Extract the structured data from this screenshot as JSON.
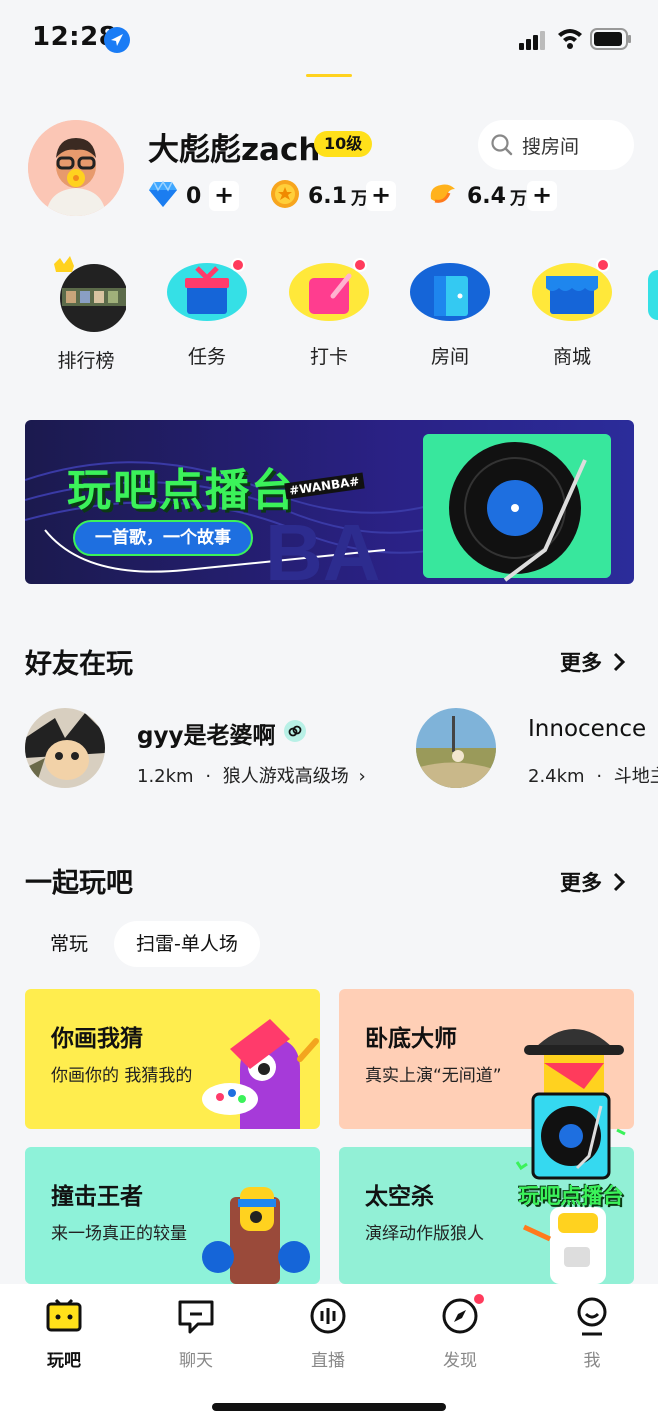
{
  "status_bar": {
    "time": "12:28"
  },
  "profile": {
    "username": "大彪彪zach",
    "level": "10级",
    "search_label": "搜房间",
    "diamonds": "0",
    "coins": {
      "value": "6.1",
      "unit": "万"
    },
    "beans": {
      "value": "6.4",
      "unit": "万"
    },
    "plus": "+"
  },
  "quick_nav": [
    {
      "label": "排行榜"
    },
    {
      "label": "任务"
    },
    {
      "label": "打卡"
    },
    {
      "label": "房间"
    },
    {
      "label": "商城"
    }
  ],
  "banner": {
    "title": "玩吧点播台",
    "tag": "#WANBA#",
    "slogan": "一首歌，一个故事"
  },
  "friends_section": {
    "title": "好友在玩",
    "more": "更多",
    "friends": [
      {
        "name": "gyy是老婆啊",
        "distance": "1.2km",
        "activity": "狼人游戏高级场"
      },
      {
        "name": "Innocence",
        "distance": "2.4km",
        "activity": "斗地主"
      }
    ]
  },
  "play_section": {
    "title": "一起玩吧",
    "more": "更多",
    "tabs": [
      {
        "label": "常玩"
      },
      {
        "label": "扫雷-单人场"
      }
    ],
    "games": [
      {
        "title": "你画我猜",
        "subtitle": "你画你的 我猜我的",
        "bg": "#ffed4e"
      },
      {
        "title": "卧底大师",
        "subtitle": "真实上演“无间道”",
        "bg": "#ffcfb6"
      },
      {
        "title": "撞击王者",
        "subtitle": "来一场真正的较量",
        "bg": "#8ef2d9"
      },
      {
        "title": "太空杀",
        "subtitle": "演绎动作版狼人",
        "bg": "#92f0d6"
      }
    ]
  },
  "floating": {
    "label": "玩吧点播台"
  },
  "tab_bar": [
    {
      "label": "玩吧"
    },
    {
      "label": "聊天"
    },
    {
      "label": "直播"
    },
    {
      "label": "发现"
    },
    {
      "label": "我"
    }
  ],
  "colors": {
    "accent": "#ffd21f",
    "badge": "#ff3b5c",
    "brand_green": "#3bf25a"
  }
}
